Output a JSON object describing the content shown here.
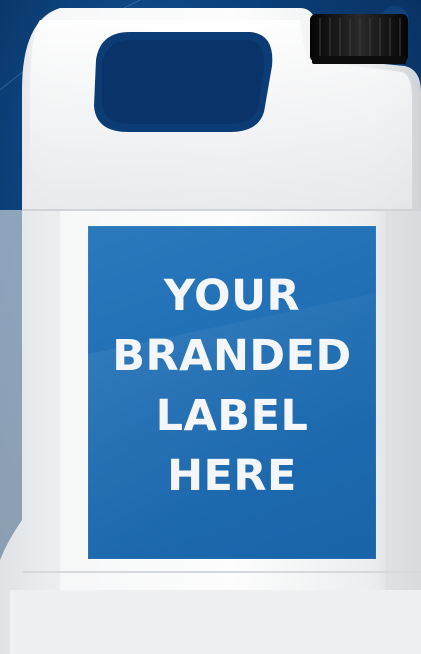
{
  "product": {
    "type": "plastic-jerrycan"
  },
  "label": {
    "line1": "YOUR",
    "line2": "BRANDED",
    "line3": "LABEL",
    "line4": "HERE"
  },
  "colors": {
    "background": "#0b3f7a",
    "label_blue": "#1f6db3",
    "container_white": "#f2f3f4",
    "cap_black": "#111111",
    "label_text": "#f4f6f9"
  }
}
